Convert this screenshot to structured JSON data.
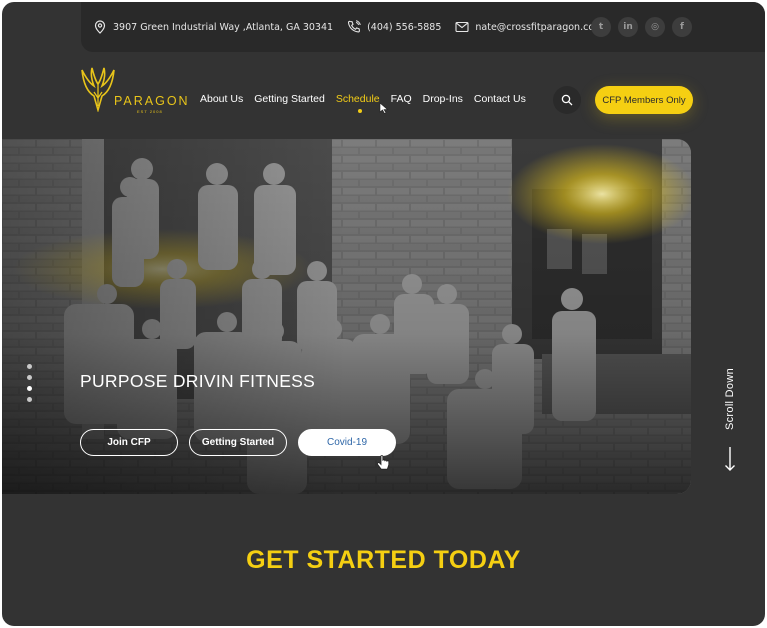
{
  "topbar": {
    "address": "3907 Green Industrial Way ,Atlanta, GA 30341",
    "phone": "(404) 556-5885",
    "email": "nate@crossfitparagon.com",
    "socials": [
      {
        "icon": "twitter-icon",
        "glyph": "t"
      },
      {
        "icon": "linkedin-icon",
        "glyph": "in"
      },
      {
        "icon": "instagram-icon",
        "glyph": "◎"
      },
      {
        "icon": "facebook-icon",
        "glyph": "f"
      }
    ]
  },
  "brand": {
    "name": "PARAGON",
    "tagline": "EST 2008"
  },
  "nav": {
    "items": [
      "About Us",
      "Getting Started",
      "Schedule",
      "FAQ",
      "Drop-Ins",
      "Contact Us"
    ],
    "active": "Schedule"
  },
  "header": {
    "members_label": "CFP Members Only"
  },
  "hero": {
    "title": "PURPOSE DRIVIN FITNESS",
    "buttons": [
      "Join CFP",
      "Getting Started",
      "Covid-19"
    ],
    "slide_count": 4,
    "active_slide": 2
  },
  "scroll_label": "Scroll Down",
  "cta_title": "GET STARTED TODAY",
  "colors": {
    "accent": "#f5cf12",
    "background": "#333333",
    "topbar": "#292929"
  }
}
